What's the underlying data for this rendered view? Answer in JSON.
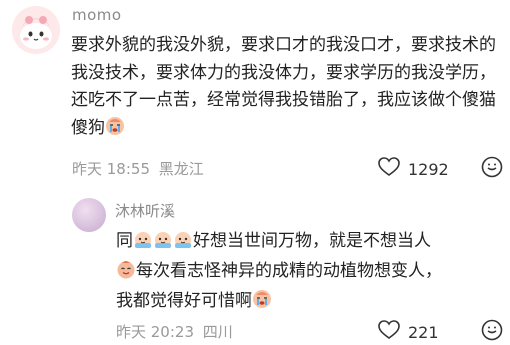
{
  "comment": {
    "username": "momo",
    "text": "要求外貌的我没外貌，要求口才的我没口才，要求技术的我没技术，要求体力的我没体力，要求学历的我没学历，还吃不了一点苦，经常觉得我投错胎了，我应该做个傻猫傻狗",
    "time": "昨天 18:55",
    "location": "黑龙江",
    "likes": "1292"
  },
  "reply": {
    "username": "沐林听溪",
    "line1_prefix": "同",
    "line1_text": "好想当世间万物，就是不想当人",
    "line2_text": "每次看志怪神异的成精的动植物想变人，",
    "line3_text": "我都觉得好可惜啊",
    "time": "昨天 20:23",
    "location": "四川",
    "likes": "221"
  },
  "icons": {
    "emoji_cry": "crying-face-emoji",
    "emoji_hehe": "shy-face-emoji",
    "like": "heart-icon",
    "reply": "comment-bubble-icon"
  },
  "colors": {
    "username": "#8a8a8a",
    "meta": "#9a9a9a",
    "text": "#222222"
  }
}
